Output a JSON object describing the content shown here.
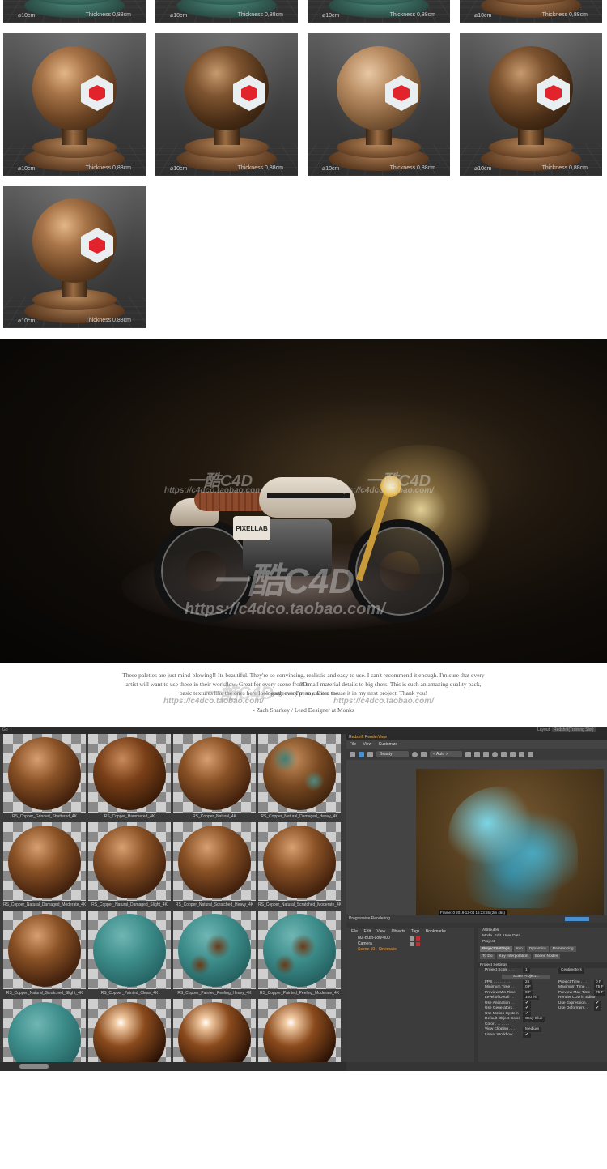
{
  "previews": {
    "caption_left": "⌀10cm",
    "caption_right": "Thickness 0,88cm",
    "caption_right_alt": "Thickness 0,88cm"
  },
  "render": {
    "brand": "PIXELLAB",
    "watermark_big": "一酷C4D",
    "watermark_url": "https://c4dco.taobao.com/"
  },
  "quote": {
    "line1": "These palettes are just mind-blowing!! Its beautiful. They're so convincing, realistic and easy to use. I can't recommend it enough. I'm sure that every 3D",
    "line2": "artist will want to use these in their workflow. Great for every scene from small material details to big shots. This is such an amazing quality pack, worth every penny. Even the",
    "line3": "basic textures like the ones here look gorgeous. I'm so excited to use it in my next project. Thank you!",
    "author": "- Zach Sharkey / Lead Designer at Monks",
    "wm_left": "https://c4dco.taobao.com/",
    "wm_mid": "一酷C4D",
    "wm_right": "https://c4dco.taobao.com/"
  },
  "c4d": {
    "top_left": "Go",
    "layout_label": "Layout:",
    "layout_value": "Redshift(Training Slot)",
    "materials": [
      "RS_Copper_Grinded_Shattered_4K",
      "RS_Copper_Hammered_4K",
      "RS_Copper_Natural_4K",
      "RS_Copper_Natural_Damaged_Heavy_4K",
      "RS_Copper_Natural_Damaged_Moderate_4K",
      "RS_Copper_Natural_Damaged_Slight_4K",
      "RS_Copper_Natural_Scratched_Heavy_4K",
      "RS_Copper_Natural_Scratched_Moderate_4K",
      "RS_Copper_Natural_Scratched_Slight_4K",
      "RS_Copper_Painted_Clean_4K",
      "RS_Copper_Painted_Peeling_Heavy_4K",
      "RS_Copper_Painted_Peeling_Moderate_4K",
      "",
      "",
      "",
      ""
    ],
    "renderview": {
      "title": "Redshift RenderView",
      "menu": [
        "File",
        "View",
        "Customize"
      ],
      "aov": "Beauty",
      "camera": "< Auto >",
      "frame_info": "Frame: 0   2019-12-04  16:23:55  (2m 46s)",
      "progress": "Progressive Rendering..."
    },
    "objects": {
      "menu": [
        "File",
        "Edit",
        "View",
        "Objects",
        "Tags",
        "Bookmarks"
      ],
      "rows": [
        "MZ-Bust-Low-000",
        "Camera",
        "Scene 10 - Cinematic"
      ]
    },
    "attributes": {
      "title": "Attributes",
      "menu": [
        "Mode",
        "Edit",
        "User Data"
      ],
      "node": "Project",
      "tabs": [
        "Project Settings",
        "Info",
        "Dynamics",
        "Referencing"
      ],
      "tabs2": [
        "To Do",
        "Key Interpolation",
        "Scene Nodes"
      ],
      "section": "Project Settings",
      "scale_label": "Project Scale . . .",
      "scale_value": "1",
      "scale_unit": "Centimeters",
      "scale_button": "Scale Project...",
      "fields": [
        {
          "l": "FPS . . . . . . . . .",
          "v": "25",
          "r": "Project Time . . .",
          "rv": "0 F"
        },
        {
          "l": "Minimum Time . .",
          "v": "0 F",
          "r": "Maximum Time . .",
          "rv": "75 F"
        },
        {
          "l": "Preview Min Time",
          "v": "0 F",
          "r": "Preview Max Time",
          "rv": "75 F"
        },
        {
          "l": "Level of Detail . .",
          "v": "100 %",
          "r": "Render LOD in Editor",
          "rv": ""
        },
        {
          "l": "Use Animation . .",
          "v": "✔",
          "r": "Use Expression. .",
          "rv": "✔"
        },
        {
          "l": "Use Generators . .",
          "v": "✔",
          "r": "Use Deformers. .",
          "rv": "✔"
        },
        {
          "l": "Use Motion System",
          "v": "✔",
          "r": "",
          "rv": ""
        },
        {
          "l": "Default Object Color",
          "v": "Gray-Blue",
          "r": "",
          "rv": ""
        },
        {
          "l": "Color . . . . . . . .",
          "v": "",
          "r": "",
          "rv": ""
        },
        {
          "l": "View Clipping . . .",
          "v": "Medium",
          "r": "",
          "rv": ""
        },
        {
          "l": "Linear Workflow . .",
          "v": "✔",
          "r": "",
          "rv": ""
        }
      ]
    }
  }
}
